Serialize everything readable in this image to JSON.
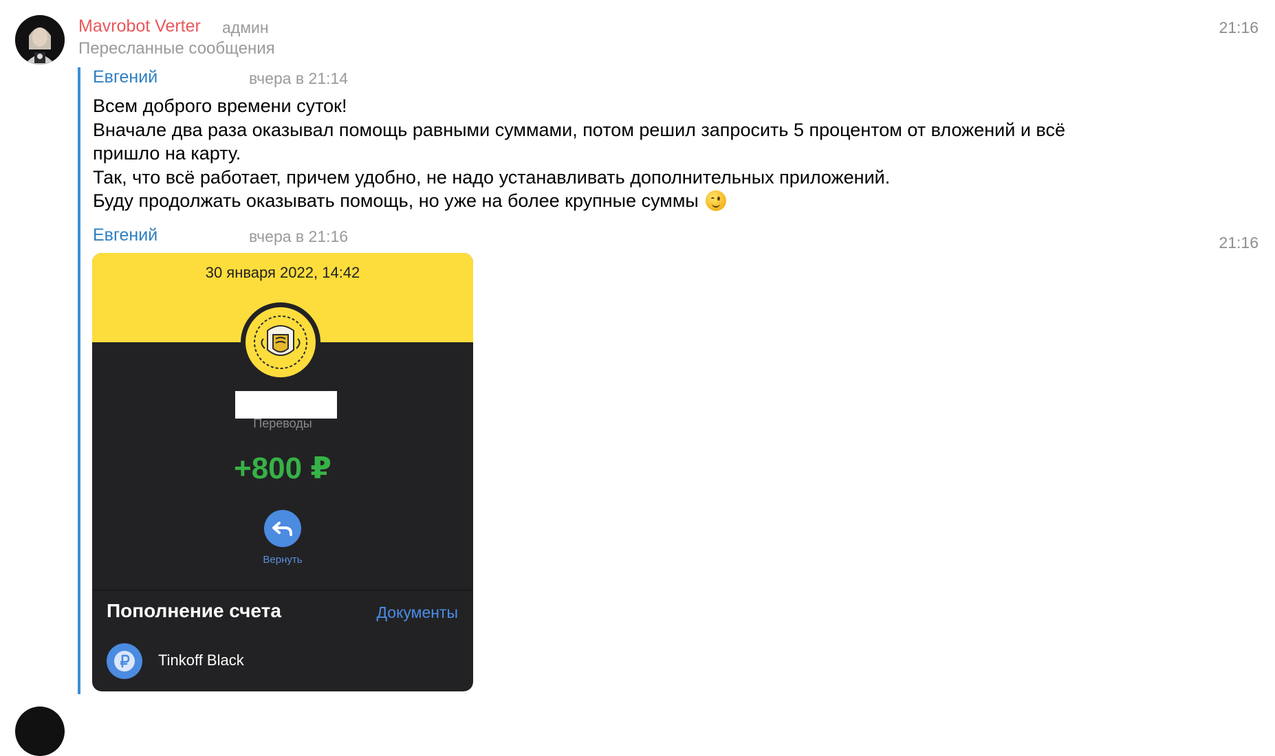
{
  "post": {
    "sender_name": "Mavrobot Verter",
    "sender_role": "админ",
    "forwarded_label": "Пересланные сообщения",
    "time": "21:16"
  },
  "forwarded": [
    {
      "author": "Евгений",
      "when": "вчера в 21:14",
      "lines": [
        "Всем доброго времени суток!",
        "Вначале два раза оказывал помощь равными суммами, потом решил запросить 5 процентом от вложений и всё",
        "пришло на карту.",
        "Так, что всё работает, причем удобно, не надо устанавливать дополнительных приложений.",
        "Буду продолжать оказывать помощь, но уже на более крупные суммы"
      ],
      "emoji": "winking-face"
    },
    {
      "author": "Евгений",
      "when": "вчера в 21:16",
      "time": "21:16",
      "screenshot": {
        "date": "30 января 2022, 14:42",
        "category": "Переводы",
        "amount": "+800 ₽",
        "return_label": "Вернуть",
        "operation_title": "Пополнение счета",
        "documents_link": "Документы",
        "account_name": "Tinkoff Black",
        "colors": {
          "yellow": "#fddd3c",
          "dark": "#222224",
          "amount_green": "#36b246",
          "link_blue": "#4a8de6"
        }
      }
    }
  ],
  "colors": {
    "sender": "#e9585b",
    "author": "#2d7fc1",
    "forward_bar": "#3d8fd6",
    "meta_gray": "#9a9a9a"
  }
}
